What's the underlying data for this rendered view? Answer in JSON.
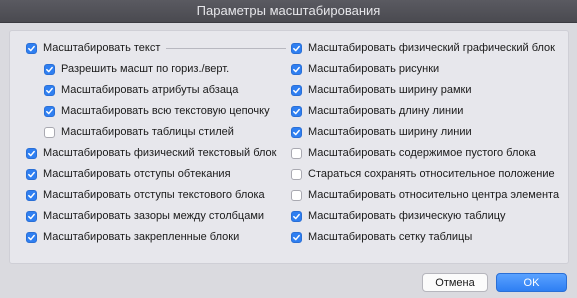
{
  "dialog": {
    "title": "Параметры масштабирования",
    "checkboxes": [
      {
        "label": "Масштабировать текст",
        "checked": true
      },
      {
        "label": "Разрешить масшт по гориз./верт.",
        "checked": true
      },
      {
        "label": "Масштабировать атрибуты абзаца",
        "checked": true
      },
      {
        "label": "Масштабировать всю текстовую цепочку",
        "checked": true
      },
      {
        "label": "Масштабировать таблицы стилей",
        "checked": false
      },
      {
        "label": "Масштабировать физический текстовый блок",
        "checked": true
      },
      {
        "label": "Масштабировать отступы обтекания",
        "checked": true
      },
      {
        "label": "Масштабировать отступы текстового блока",
        "checked": true
      },
      {
        "label": "Масштабировать зазоры между столбцами",
        "checked": true
      },
      {
        "label": "Масштабировать закрепленные блоки",
        "checked": true
      },
      {
        "label": "Масштабировать физический графический блок",
        "checked": true
      },
      {
        "label": "Масштабировать рисунки",
        "checked": true
      },
      {
        "label": "Масштабировать ширину рамки",
        "checked": true
      },
      {
        "label": "Масштабировать длину линии",
        "checked": true
      },
      {
        "label": "Масштабировать ширину линии",
        "checked": true
      },
      {
        "label": "Масштабировать содержимое пустого блока",
        "checked": false
      },
      {
        "label": "Стараться сохранять относительное положение",
        "checked": false
      },
      {
        "label": "Масштабировать относительно центра элемента",
        "checked": false
      },
      {
        "label": "Масштабировать физическую таблицу",
        "checked": true
      },
      {
        "label": "Масштабировать сетку таблицы",
        "checked": true
      }
    ],
    "buttons": {
      "cancel": "Отмена",
      "ok": "OK"
    },
    "colors": {
      "accent": "#2f7ff1",
      "titlebar": "#4f4f55"
    }
  }
}
